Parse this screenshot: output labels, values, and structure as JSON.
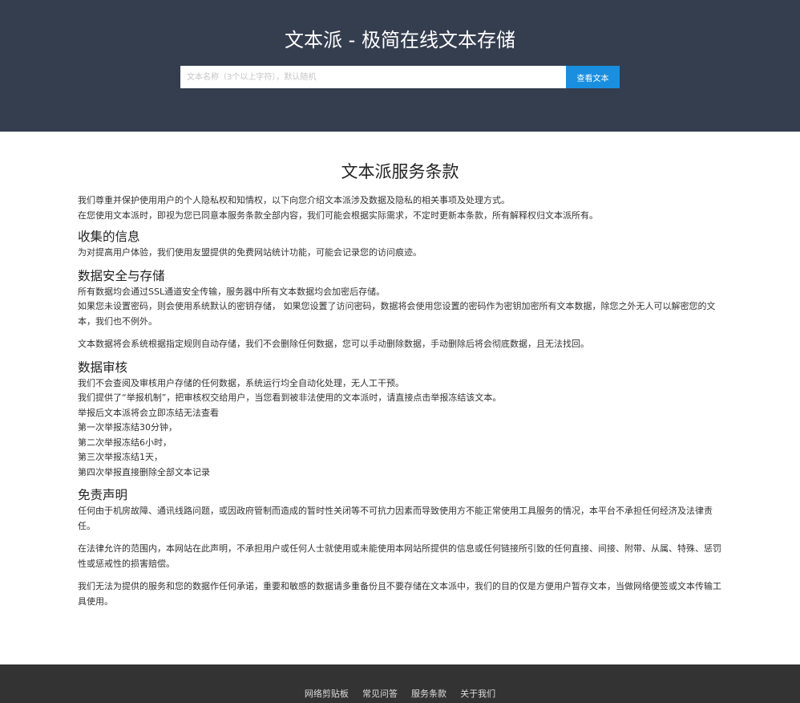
{
  "header": {
    "title": "文本派 - 极简在线文本存储",
    "search_placeholder": "文本名称（3个以上字符），默认随机",
    "search_value": "",
    "search_button": "查看文本"
  },
  "page": {
    "title": "文本派服务条款",
    "intro": [
      "我们尊重并保护使用用户的个人隐私权和知情权，以下向您介绍文本派涉及数据及隐私的相关事项及处理方式。",
      "在您使用文本派时，即视为您已同意本服务条款全部内容，我们可能会根据实际需求，不定时更新本条款，所有解释权归文本派所有。"
    ],
    "sections": {
      "collect": {
        "heading": "收集的信息",
        "lines": [
          "为对提高用户体验，我们使用友盟提供的免费网站统计功能，可能会记录您的访问痕迹。"
        ]
      },
      "security": {
        "heading": "数据安全与存储",
        "lines": [
          "所有数据均会通过SSL通道安全传输，服务器中所有文本数据均会加密后存储。",
          "如果您未设置密码，则会使用系统默认的密钥存储， 如果您设置了访问密码，数据将会使用您设置的密码作为密钥加密所有文本数据，除您之外无人可以解密您的文本，我们也不例外。",
          "文本数据将会系统根据指定规则自动存储，我们不会删除任何数据，您可以手动删除数据，手动删除后将会彻底数据，且无法找回。"
        ]
      },
      "review": {
        "heading": "数据审核",
        "lines": [
          "我们不会查阅及审核用户存储的任何数据，系统运行均全自动化处理，无人工干预。",
          "我们提供了“举报机制”，把审核权交给用户，当您看到被非法使用的文本派时，请直接点击举报冻结该文本。",
          "举报后文本派将会立即冻结无法查看",
          "第一次举报冻结30分钟，",
          "第二次举报冻结6小时，",
          "第三次举报冻结1天，",
          "第四次举报直接删除全部文本记录"
        ]
      },
      "disclaimer": {
        "heading": "免责声明",
        "lines": [
          "任何由于机房故障、通讯线路问题，或因政府管制而造成的暂时性关闭等不可抗力因素而导致使用方不能正常使用工具服务的情况，本平台不承担任何经济及法律责任。",
          "在法律允许的范围内，本网站在此声明，不承担用户或任何人士就使用或未能使用本网站所提供的信息或任何链接所引致的任何直接、间接、附带、从属、特殊、惩罚性或惩戒性的损害赔偿。",
          "我们无法为提供的服务和您的数据作任何承诺，重要和敏感的数据请多重备份且不要存储在文本派中，我们的目的仅是方便用户暂存文本，当做网络便签或文本传输工具使用。"
        ]
      }
    }
  },
  "footer": {
    "links": [
      "网络剪贴板",
      "常见问答",
      "服务条款",
      "关于我们"
    ]
  },
  "colors": {
    "header_bg": "#353e4f",
    "accent": "#1a8fe0",
    "footer_bg": "#333333"
  }
}
